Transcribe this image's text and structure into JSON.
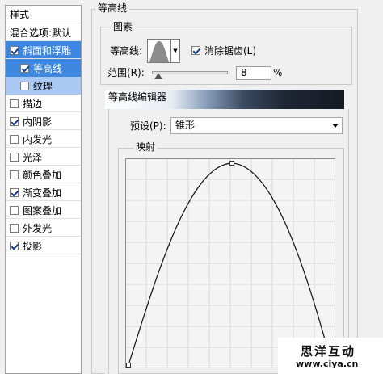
{
  "styles_panel": {
    "items": [
      {
        "label": "样式",
        "type": "header"
      },
      {
        "label": "混合选项:默认",
        "type": "header"
      },
      {
        "label": "斜面和浮雕",
        "checked": true,
        "selected": true
      },
      {
        "label": "等高线",
        "checked": true,
        "selected": true,
        "sub": true
      },
      {
        "label": "纹理",
        "checked": false,
        "sub": true
      },
      {
        "label": "描边",
        "checked": false
      },
      {
        "label": "内阴影",
        "checked": true
      },
      {
        "label": "内发光",
        "checked": false
      },
      {
        "label": "光泽",
        "checked": false
      },
      {
        "label": "颜色叠加",
        "checked": false
      },
      {
        "label": "渐变叠加",
        "checked": true
      },
      {
        "label": "图案叠加",
        "checked": false
      },
      {
        "label": "外发光",
        "checked": false
      },
      {
        "label": "投影",
        "checked": true
      }
    ]
  },
  "contour_section": {
    "title": "等高线",
    "elements_title": "图素",
    "contour_label": "等高线:",
    "dropdown_arrow": "▼",
    "anti_alias_label": "消除锯齿(L)",
    "anti_alias_checked": true,
    "range_label": "范围(R):",
    "range_value": "8",
    "range_unit": "%",
    "range_slider_fraction": 0.08
  },
  "contour_editor": {
    "title": "等高线编辑器",
    "preset_label": "预设(P):",
    "preset_value": "锥形",
    "mapping_title": "映射"
  },
  "watermark": {
    "name": "思洋互动",
    "url": "www.ciya.cn"
  },
  "colors": {
    "selection": "#3d87e0",
    "sub_item": "#a9c9f2",
    "border": "#c8c8c8"
  }
}
